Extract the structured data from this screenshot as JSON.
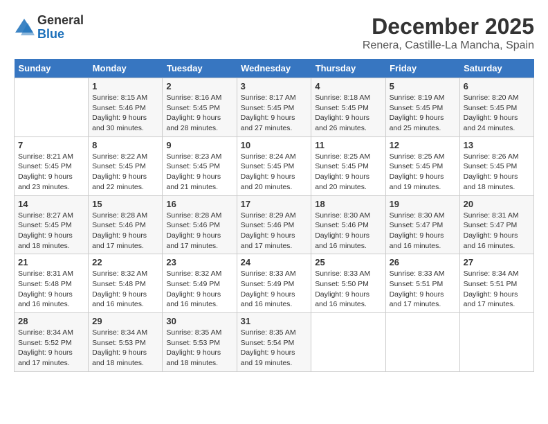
{
  "logo": {
    "general": "General",
    "blue": "Blue"
  },
  "title": "December 2025",
  "location": "Renera, Castille-La Mancha, Spain",
  "headers": [
    "Sunday",
    "Monday",
    "Tuesday",
    "Wednesday",
    "Thursday",
    "Friday",
    "Saturday"
  ],
  "weeks": [
    [
      {
        "day": "",
        "info": ""
      },
      {
        "day": "1",
        "info": "Sunrise: 8:15 AM\nSunset: 5:46 PM\nDaylight: 9 hours\nand 30 minutes."
      },
      {
        "day": "2",
        "info": "Sunrise: 8:16 AM\nSunset: 5:45 PM\nDaylight: 9 hours\nand 28 minutes."
      },
      {
        "day": "3",
        "info": "Sunrise: 8:17 AM\nSunset: 5:45 PM\nDaylight: 9 hours\nand 27 minutes."
      },
      {
        "day": "4",
        "info": "Sunrise: 8:18 AM\nSunset: 5:45 PM\nDaylight: 9 hours\nand 26 minutes."
      },
      {
        "day": "5",
        "info": "Sunrise: 8:19 AM\nSunset: 5:45 PM\nDaylight: 9 hours\nand 25 minutes."
      },
      {
        "day": "6",
        "info": "Sunrise: 8:20 AM\nSunset: 5:45 PM\nDaylight: 9 hours\nand 24 minutes."
      }
    ],
    [
      {
        "day": "7",
        "info": "Sunrise: 8:21 AM\nSunset: 5:45 PM\nDaylight: 9 hours\nand 23 minutes."
      },
      {
        "day": "8",
        "info": "Sunrise: 8:22 AM\nSunset: 5:45 PM\nDaylight: 9 hours\nand 22 minutes."
      },
      {
        "day": "9",
        "info": "Sunrise: 8:23 AM\nSunset: 5:45 PM\nDaylight: 9 hours\nand 21 minutes."
      },
      {
        "day": "10",
        "info": "Sunrise: 8:24 AM\nSunset: 5:45 PM\nDaylight: 9 hours\nand 20 minutes."
      },
      {
        "day": "11",
        "info": "Sunrise: 8:25 AM\nSunset: 5:45 PM\nDaylight: 9 hours\nand 20 minutes."
      },
      {
        "day": "12",
        "info": "Sunrise: 8:25 AM\nSunset: 5:45 PM\nDaylight: 9 hours\nand 19 minutes."
      },
      {
        "day": "13",
        "info": "Sunrise: 8:26 AM\nSunset: 5:45 PM\nDaylight: 9 hours\nand 18 minutes."
      }
    ],
    [
      {
        "day": "14",
        "info": "Sunrise: 8:27 AM\nSunset: 5:45 PM\nDaylight: 9 hours\nand 18 minutes."
      },
      {
        "day": "15",
        "info": "Sunrise: 8:28 AM\nSunset: 5:46 PM\nDaylight: 9 hours\nand 17 minutes."
      },
      {
        "day": "16",
        "info": "Sunrise: 8:28 AM\nSunset: 5:46 PM\nDaylight: 9 hours\nand 17 minutes."
      },
      {
        "day": "17",
        "info": "Sunrise: 8:29 AM\nSunset: 5:46 PM\nDaylight: 9 hours\nand 17 minutes."
      },
      {
        "day": "18",
        "info": "Sunrise: 8:30 AM\nSunset: 5:46 PM\nDaylight: 9 hours\nand 16 minutes."
      },
      {
        "day": "19",
        "info": "Sunrise: 8:30 AM\nSunset: 5:47 PM\nDaylight: 9 hours\nand 16 minutes."
      },
      {
        "day": "20",
        "info": "Sunrise: 8:31 AM\nSunset: 5:47 PM\nDaylight: 9 hours\nand 16 minutes."
      }
    ],
    [
      {
        "day": "21",
        "info": "Sunrise: 8:31 AM\nSunset: 5:48 PM\nDaylight: 9 hours\nand 16 minutes."
      },
      {
        "day": "22",
        "info": "Sunrise: 8:32 AM\nSunset: 5:48 PM\nDaylight: 9 hours\nand 16 minutes."
      },
      {
        "day": "23",
        "info": "Sunrise: 8:32 AM\nSunset: 5:49 PM\nDaylight: 9 hours\nand 16 minutes."
      },
      {
        "day": "24",
        "info": "Sunrise: 8:33 AM\nSunset: 5:49 PM\nDaylight: 9 hours\nand 16 minutes."
      },
      {
        "day": "25",
        "info": "Sunrise: 8:33 AM\nSunset: 5:50 PM\nDaylight: 9 hours\nand 16 minutes."
      },
      {
        "day": "26",
        "info": "Sunrise: 8:33 AM\nSunset: 5:51 PM\nDaylight: 9 hours\nand 17 minutes."
      },
      {
        "day": "27",
        "info": "Sunrise: 8:34 AM\nSunset: 5:51 PM\nDaylight: 9 hours\nand 17 minutes."
      }
    ],
    [
      {
        "day": "28",
        "info": "Sunrise: 8:34 AM\nSunset: 5:52 PM\nDaylight: 9 hours\nand 17 minutes."
      },
      {
        "day": "29",
        "info": "Sunrise: 8:34 AM\nSunset: 5:53 PM\nDaylight: 9 hours\nand 18 minutes."
      },
      {
        "day": "30",
        "info": "Sunrise: 8:35 AM\nSunset: 5:53 PM\nDaylight: 9 hours\nand 18 minutes."
      },
      {
        "day": "31",
        "info": "Sunrise: 8:35 AM\nSunset: 5:54 PM\nDaylight: 9 hours\nand 19 minutes."
      },
      {
        "day": "",
        "info": ""
      },
      {
        "day": "",
        "info": ""
      },
      {
        "day": "",
        "info": ""
      }
    ]
  ]
}
